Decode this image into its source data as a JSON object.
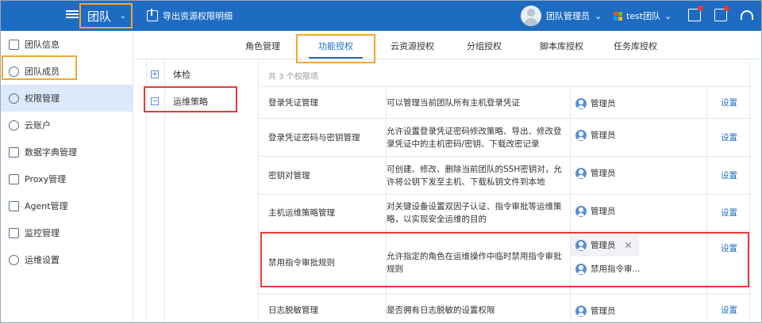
{
  "topbar": {
    "team_label": "团队",
    "export_label": "导出资源权限明细",
    "user_name": "团队管理员",
    "tenant_name": "test团队",
    "colors": {
      "bar": "#1e6cc2",
      "highlight_orange": "#f0a830",
      "highlight_red": "#e23b3b"
    }
  },
  "sidebar": {
    "items": [
      {
        "label": "团队信息",
        "icon": "document-icon"
      },
      {
        "label": "团队成员",
        "icon": "users-icon"
      },
      {
        "label": "权限管理",
        "icon": "user-gear-icon",
        "active": true
      },
      {
        "label": "云账户",
        "icon": "cloud-icon"
      },
      {
        "label": "数据字典管理",
        "icon": "book-icon"
      },
      {
        "label": "Proxy管理",
        "icon": "proxy-icon"
      },
      {
        "label": "Agent管理",
        "icon": "agent-icon"
      },
      {
        "label": "监控管理",
        "icon": "monitor-icon"
      },
      {
        "label": "运维设置",
        "icon": "shield-gear-icon"
      }
    ]
  },
  "tabs": [
    {
      "label": "角色管理"
    },
    {
      "label": "功能授权",
      "active": true
    },
    {
      "label": "云资源授权"
    },
    {
      "label": "分组授权"
    },
    {
      "label": "脚本库授权"
    },
    {
      "label": "任务库授权"
    }
  ],
  "tree": [
    {
      "label": "体检",
      "toggle": "+"
    },
    {
      "label": "运维策略",
      "toggle": "−",
      "selected": true
    }
  ],
  "table": {
    "count_text": "共 3 个权限项",
    "action_label": "设置",
    "rows": [
      {
        "name": "登录凭证管理",
        "desc": "可以管理当前团队所有主机登录凭证",
        "roles": [
          "管理员"
        ]
      },
      {
        "name": "登录凭证密码与密钥管理",
        "desc": "允许设置登录凭证密码修改策略、导出、修改登录凭证中的主机密码/密钥、下载改密记录",
        "roles": [
          "管理员"
        ]
      },
      {
        "name": "密钥对管理",
        "desc": "可创建、修改、删除当前团队的SSH密钥对，允许将公钥下发至主机、下载私钥文件到本地",
        "roles": [
          "管理员"
        ]
      },
      {
        "name": "主机运维策略管理",
        "desc": "对关键设备设置双因子认证、指令审批等运维策略，以实现安全运维的目的",
        "roles": [
          "管理员"
        ]
      },
      {
        "name": "禁用指令审批规则",
        "desc": "允许指定的角色在运维操作中临时禁用指令审批规则",
        "roles": [
          "管理员",
          "禁用指令审..."
        ]
      },
      {
        "name": "日志脱敏管理",
        "desc": "是否拥有日志脱敏的设置权限",
        "roles": [
          "管理员"
        ]
      }
    ]
  }
}
